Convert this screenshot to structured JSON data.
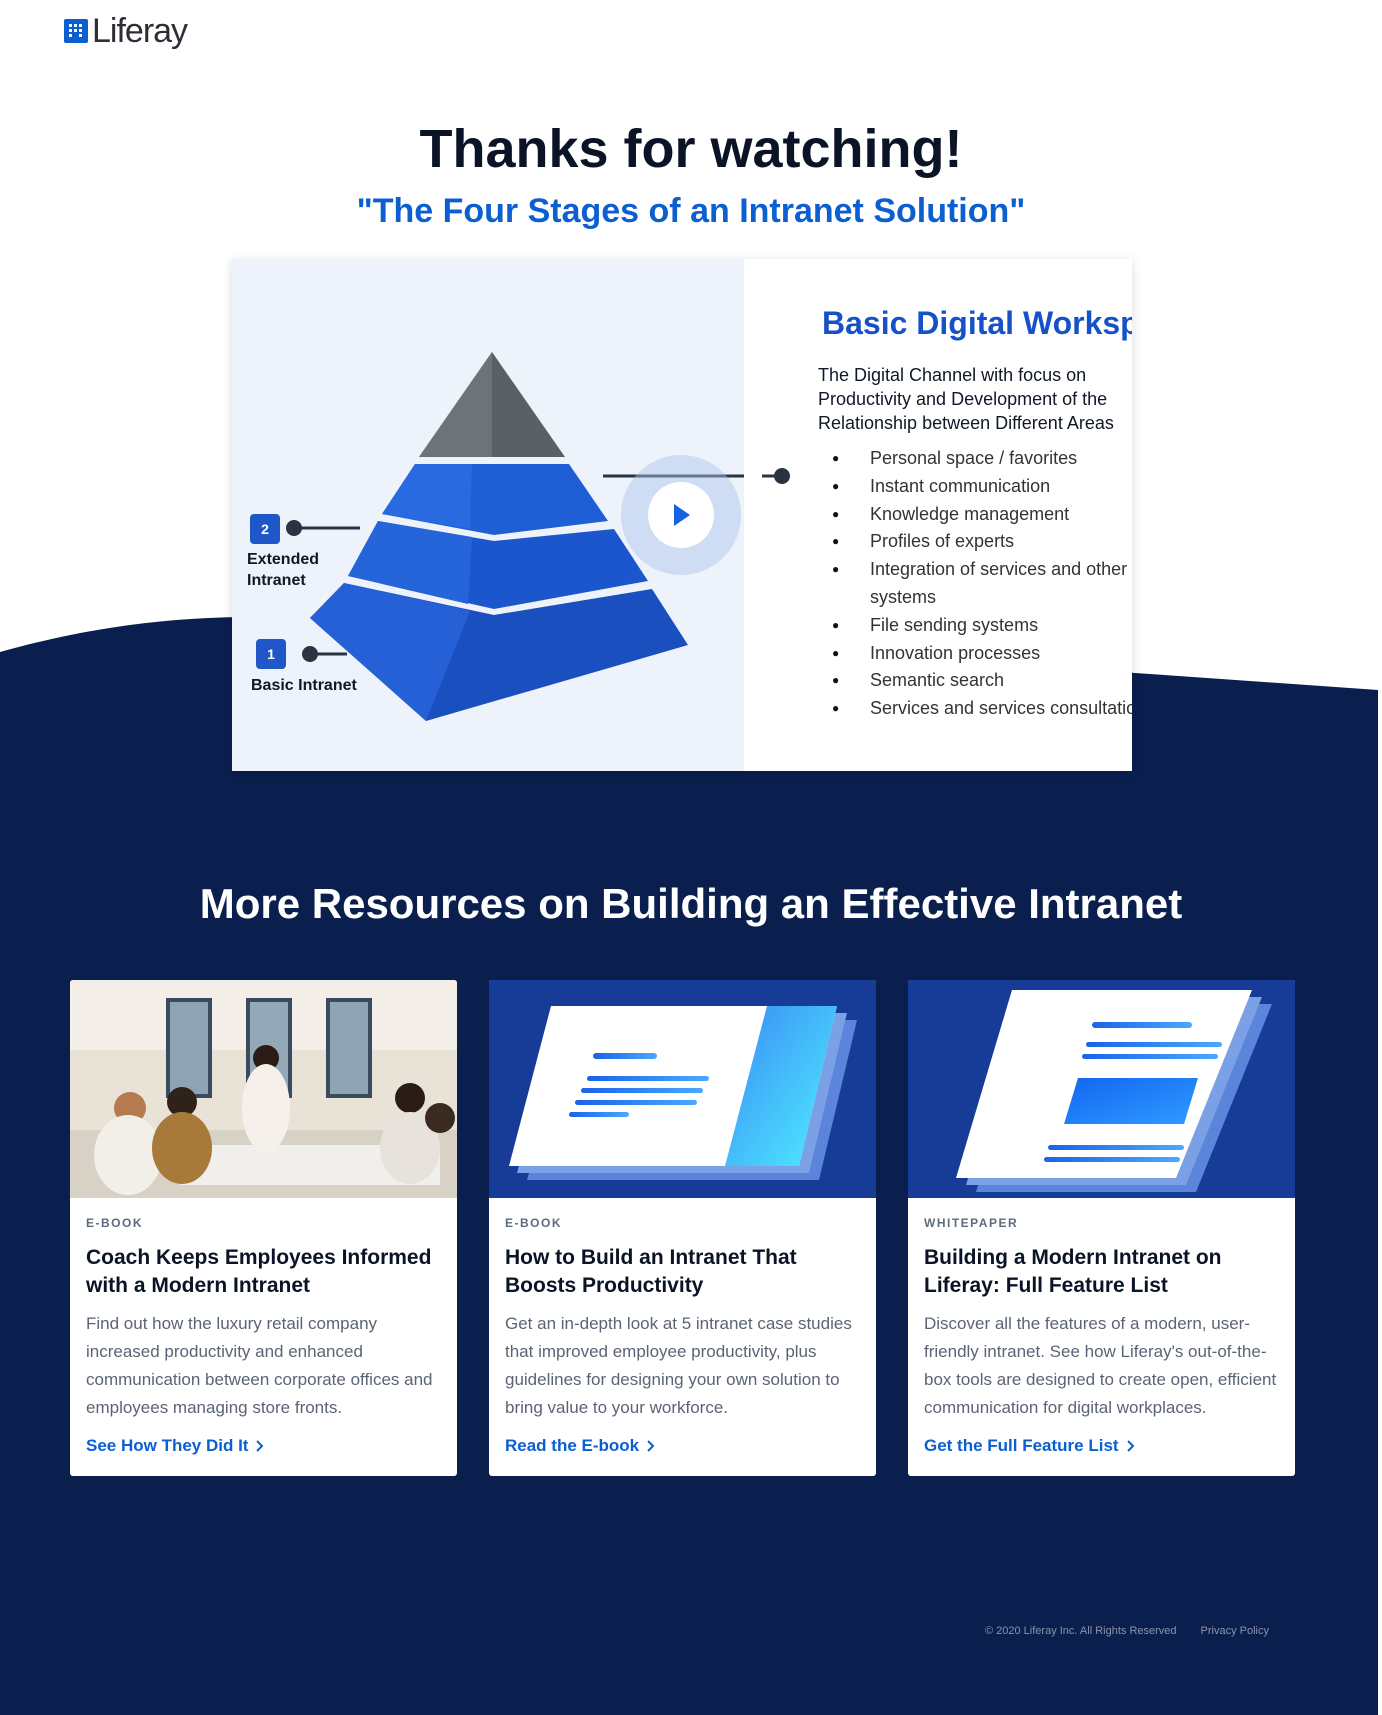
{
  "header": {
    "logo_text": "Liferay"
  },
  "hero": {
    "title": "Thanks for watching!",
    "subtitle": "\"The Four Stages of an Intranet Solution\""
  },
  "video": {
    "play_icon": "play-icon",
    "slide": {
      "title": "Basic Digital Workspa",
      "description": "The Digital Channel with focus on Productivity and Development of the Relationship between Different Areas",
      "items": [
        "Personal space / favorites",
        "Instant communication",
        "Knowledge management",
        "Profiles of experts",
        "Integration of services and other systems",
        "File sending systems",
        "Innovation processes",
        "Semantic search",
        "Services and services consultatio"
      ]
    },
    "stages": [
      {
        "number": "2",
        "label": "Extended Intranet"
      },
      {
        "number": "1",
        "label": "Basic Intranet"
      }
    ]
  },
  "resources": {
    "title": "More Resources on Building an Effective Intranet",
    "cards": [
      {
        "type": "E-BOOK",
        "title": "Coach Keeps Employees Informed with a Modern Intranet",
        "description": "Find out how the luxury retail company increased productivity and enhanced communication between corporate offices and employees managing store fronts.",
        "link": "See How They Did It"
      },
      {
        "type": "E-BOOK",
        "title": "How to Build an Intranet That Boosts Productivity",
        "description": "Get an in-depth look at 5 intranet case studies that improved employee productivity, plus guidelines for designing your own solution to bring value to your workforce.",
        "link": "Read the E-book"
      },
      {
        "type": "WHITEPAPER",
        "title": "Building a Modern Intranet on Liferay: Full Feature List",
        "description": "Discover all the features of a modern, user-friendly intranet. See how Liferay's out-of-the-box tools are designed to create open, efficient communication for digital workplaces.",
        "link": "Get the Full Feature List"
      }
    ]
  },
  "footer": {
    "copyright": "© 2020 Liferay Inc. All Rights Reserved",
    "privacy": "Privacy Policy"
  },
  "colors": {
    "navy": "#0a1f4e",
    "accent": "#0b5fd1",
    "pyramid_blue": "#1f57c8"
  }
}
